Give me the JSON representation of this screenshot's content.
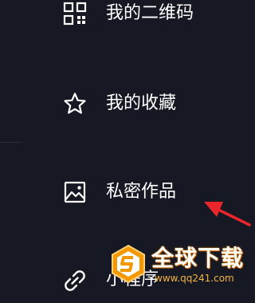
{
  "menu": {
    "items": [
      {
        "label": "我的二维码",
        "icon": "qr-code-icon"
      },
      {
        "label": "我的收藏",
        "icon": "star-icon"
      },
      {
        "label": "私密作品",
        "icon": "image-icon"
      },
      {
        "label": "小程序",
        "icon": "link-icon"
      }
    ]
  },
  "watermark": {
    "title": "全球下载",
    "url": "www.qq241.com"
  },
  "colors": {
    "background": "#161823",
    "text": "#ffffff",
    "annotation_arrow": "#e8262b",
    "watermark_orange": "#f39800"
  }
}
